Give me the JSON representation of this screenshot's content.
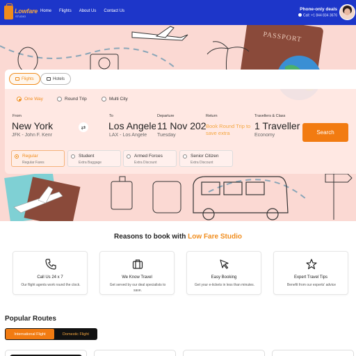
{
  "brand": {
    "logo_text": "Lowfare",
    "logo_sub": "STUDIO",
    "accent": "#f08c1c",
    "header_color": "#1d36c9"
  },
  "nav": [
    "Home",
    "Flights",
    "About Us",
    "Contact Us"
  ],
  "deals": {
    "title": "Phone-only deals",
    "phone": "Call: +1 844 834 3676"
  },
  "search_tabs": [
    "Flights",
    "Hotels"
  ],
  "trip_types": [
    "One Way",
    "Round Trip",
    "Multi City"
  ],
  "selected_trip": "One Way",
  "fields": {
    "from_label": "From",
    "from_city": "New York",
    "from_airport": "JFK - John F. Kenr",
    "to_label": "To",
    "to_city": "Los Angele",
    "to_airport": "LAX - Los Angele",
    "departure_label": "Departure",
    "departure_date": "11 Nov 202",
    "departure_day": "Tuesday",
    "return_label": "Return",
    "return_note": "Book Round Trip to save extra",
    "travellers_label": "Travellers & Class",
    "travellers_value": "1 Traveller",
    "class_value": "Economy"
  },
  "search_button": "Search",
  "fares": [
    {
      "name": "Regular",
      "sub": "Regular Fares",
      "selected": true
    },
    {
      "name": "Student",
      "sub": "Extra Baggage",
      "selected": false
    },
    {
      "name": "Armed Forces",
      "sub": "Extra Discount",
      "selected": false
    },
    {
      "name": "Senior Citizen",
      "sub": "Extra Discount",
      "selected": false
    }
  ],
  "reasons": {
    "title_prefix": "Reasons to book with ",
    "title_brand": "Low Fare Studio",
    "cards": [
      {
        "icon": "phone-icon",
        "title": "Call Us 24 x 7",
        "text": "Our flight agents work round the clock."
      },
      {
        "icon": "briefcase-icon",
        "title": "We Know Travel",
        "text": "Get served by our deal specialists to save."
      },
      {
        "icon": "cursor-icon",
        "title": "Easy Booking",
        "text": "Get your e-tickets in less than minutes."
      },
      {
        "icon": "star-icon",
        "title": "Expert Travel Tips",
        "text": "Benefit from our experts' advice"
      }
    ]
  },
  "popular_routes": {
    "title": "Popular Routes",
    "toggles": [
      "International Flight",
      "Domestic Flight"
    ],
    "active_toggle": "International Flight"
  }
}
